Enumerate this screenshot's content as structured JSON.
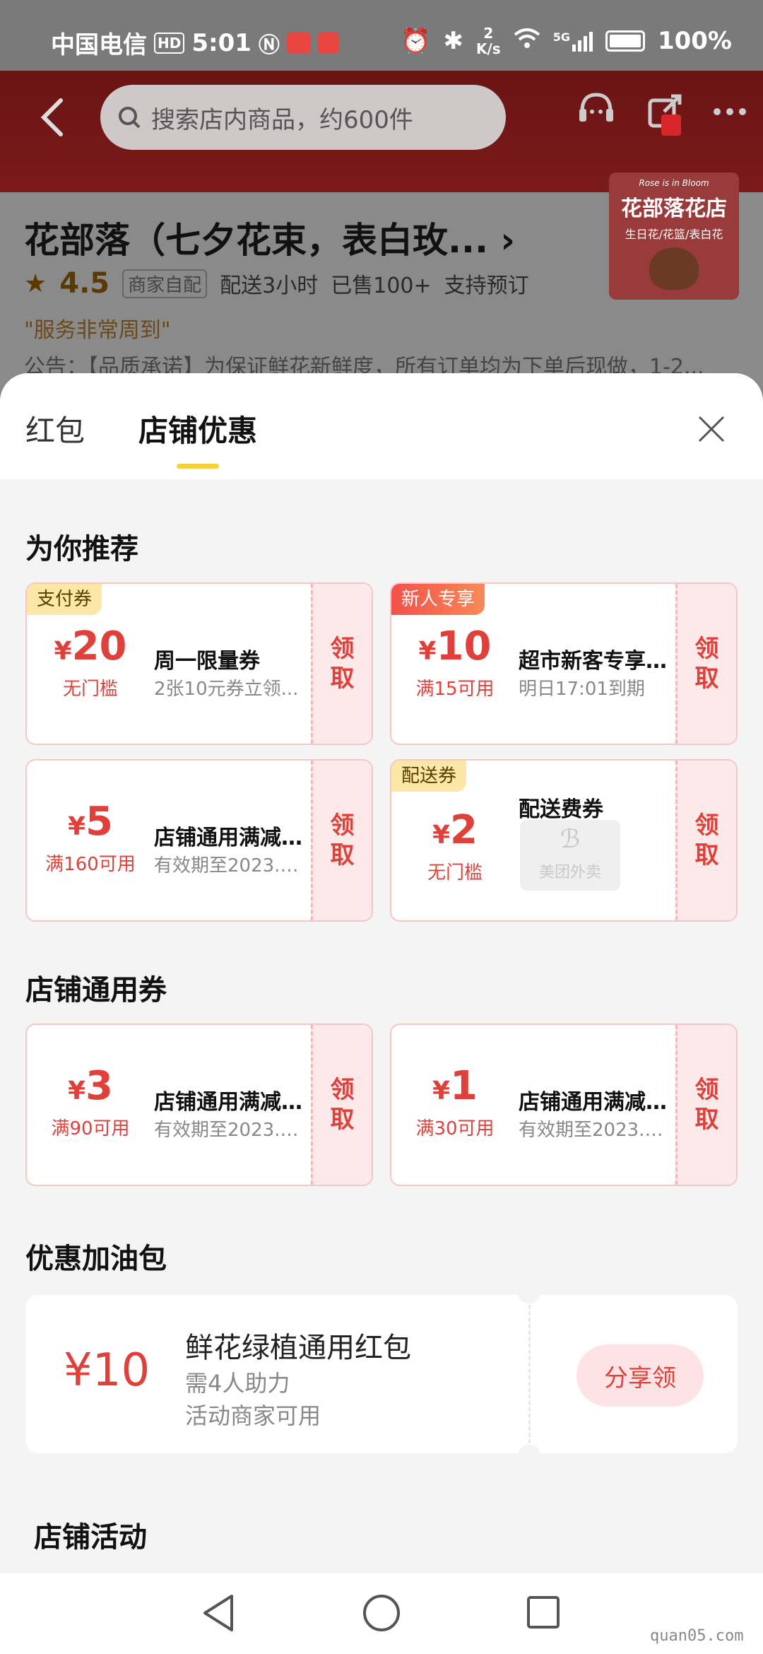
{
  "status": {
    "carrier": "中国电信",
    "hd": "HD",
    "time": "5:01",
    "speed_top": "2",
    "speed_bottom": "K/s",
    "net": "5G",
    "battery": "100%"
  },
  "header": {
    "search_placeholder": "搜索店内商品，约600件",
    "shop_name": "花部落（七夕花束，表白玫...",
    "rating": "4.5",
    "tag": "商家自配",
    "delivery": "配送3小时",
    "sold": "已售100+",
    "preorder": "支持预订",
    "quote": "\"服务非常周到\"",
    "notice": "公告：【品质承诺】为保证鲜花新鲜度，所有订单均为下单后现做，1-2...",
    "logo_top": "Rose is in Bloom",
    "logo_title": "花部落花店",
    "logo_sub": "生日花/花篮/表白花"
  },
  "tabs": {
    "tab1": "红包",
    "tab2": "店铺优惠"
  },
  "sections": {
    "recommend": "为你推荐",
    "store_general": "店铺通用券",
    "package": "优惠加油包",
    "activity": "店铺活动"
  },
  "coupons": {
    "c1": {
      "badge": "支付券",
      "currency": "¥",
      "amount": "20",
      "condition": "无门槛",
      "title": "周一限量券",
      "sub": "2张10元券立领...",
      "claim1": "领",
      "claim2": "取"
    },
    "c2": {
      "badge": "新人专享",
      "currency": "¥",
      "amount": "10",
      "condition": "满15可用",
      "title": "超市新客专享...",
      "sub": "明日17:01到期",
      "claim1": "领",
      "claim2": "取"
    },
    "c3": {
      "currency": "¥",
      "amount": "5",
      "condition": "满160可用",
      "title": "店铺通用满减...",
      "sub": "有效期至2023.0...",
      "claim1": "领",
      "claim2": "取"
    },
    "c4": {
      "badge": "配送券",
      "currency": "¥",
      "amount": "2",
      "condition": "无门槛",
      "title": "配送费券",
      "brand": "美团外卖",
      "claim1": "领",
      "claim2": "取"
    },
    "c5": {
      "currency": "¥",
      "amount": "3",
      "condition": "满90可用",
      "title": "店铺通用满减...",
      "sub": "有效期至2023.0...",
      "claim1": "领",
      "claim2": "取"
    },
    "c6": {
      "currency": "¥",
      "amount": "1",
      "condition": "满30可用",
      "title": "店铺通用满减...",
      "sub": "有效期至2023.0...",
      "claim1": "领",
      "claim2": "取"
    }
  },
  "package": {
    "amount": "¥10",
    "title": "鲜花绿植通用红包",
    "line1": "需4人助力",
    "line2": "活动商家可用",
    "button": "分享领"
  },
  "watermark": "quan05.com",
  "colors": {
    "accent": "#e0403a",
    "tab_indicator": "#f5d23a",
    "coupon_bg": "#fde9e9"
  }
}
